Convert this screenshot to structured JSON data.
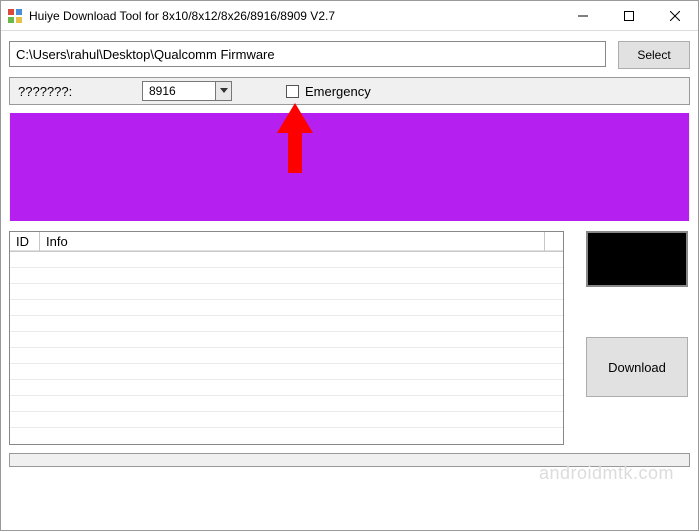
{
  "window": {
    "title": "Huiye Download Tool for 8x10/8x12/8x26/8916/8909 V2.7"
  },
  "path": {
    "value": "C:\\Users\\rahul\\Desktop\\Qualcomm Firmware"
  },
  "buttons": {
    "select": "Select",
    "download": "Download"
  },
  "config": {
    "label": "???????:",
    "combo_value": "8916",
    "emergency_label": "Emergency"
  },
  "table": {
    "headers": {
      "id": "ID",
      "info": "Info"
    }
  },
  "watermark": "androidmtk.com"
}
